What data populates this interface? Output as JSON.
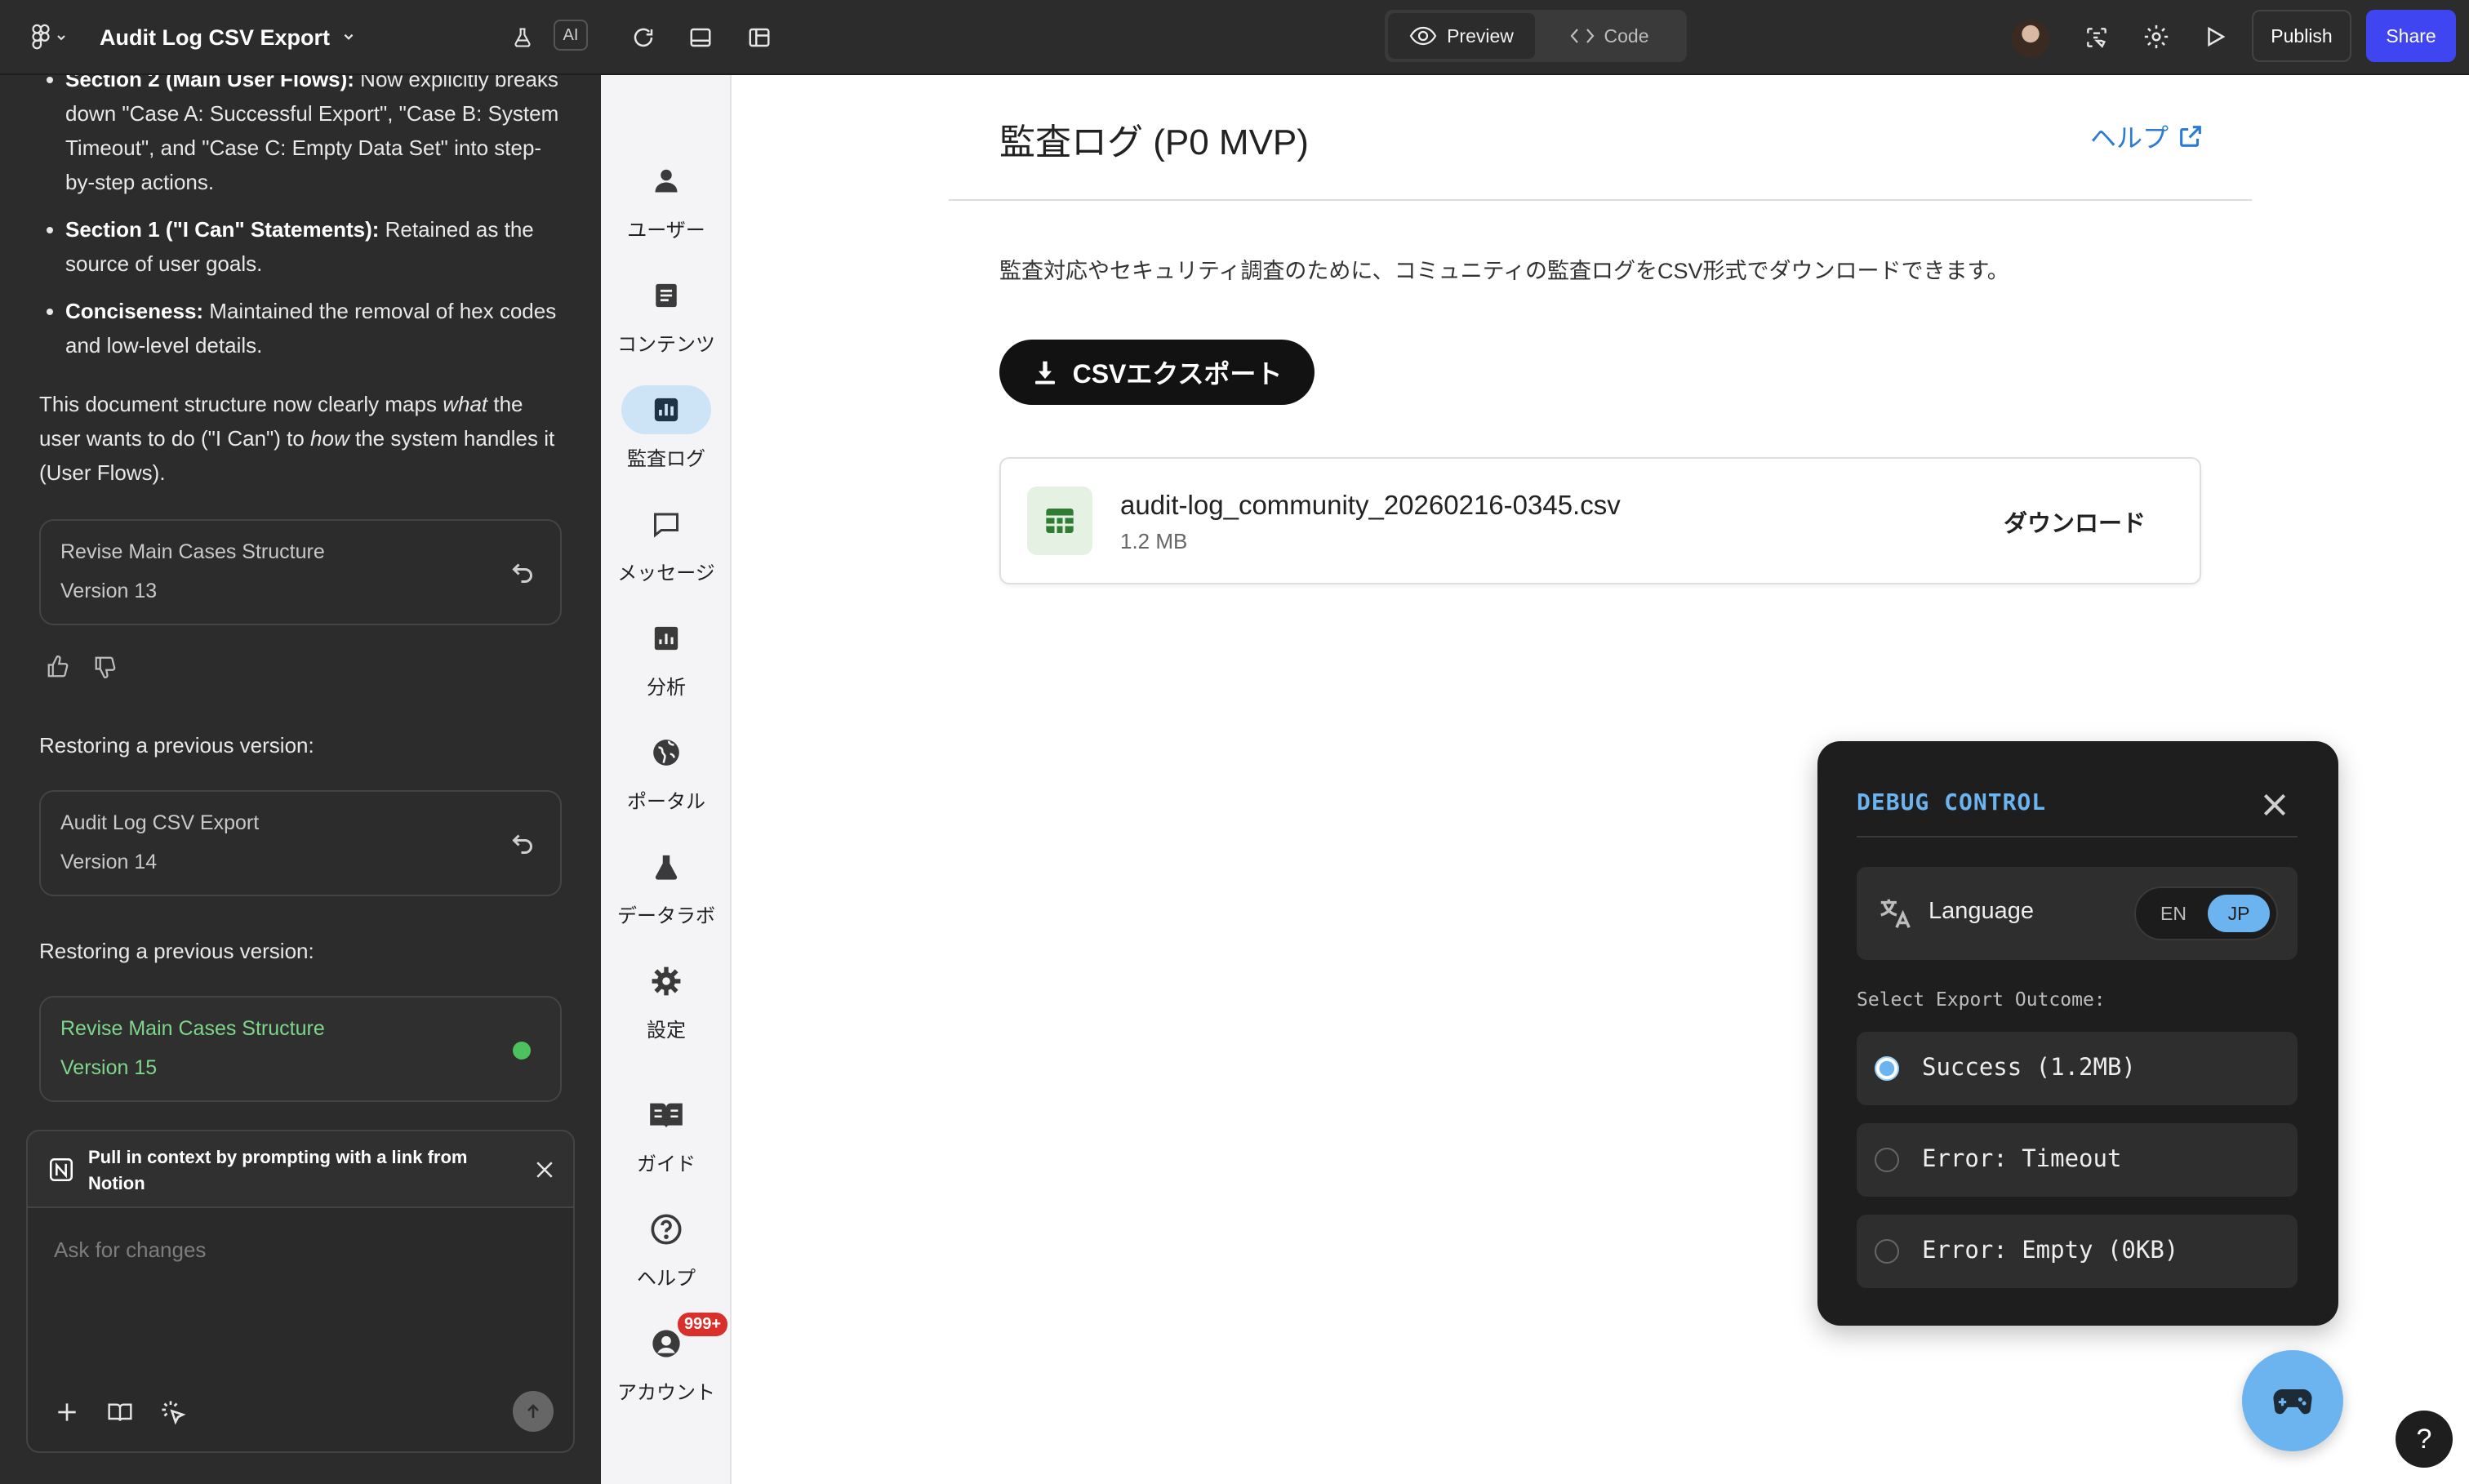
{
  "topbar": {
    "title": "Audit Log CSV Export",
    "ai_label": "AI",
    "preview_label": "Preview",
    "code_label": "Code",
    "publish_label": "Publish",
    "share_label": "Share"
  },
  "chat": {
    "bullets": [
      {
        "bold": "Section 2 (Main User Flows):",
        "text": " Now explicitly breaks down \"Case A: Successful Export\", \"Case B: System Timeout\", and \"Case C: Empty Data Set\" into step-by-step actions."
      },
      {
        "bold": "Section 1 (\"I Can\" Statements):",
        "text": " Retained as the source of user goals."
      },
      {
        "bold": "Conciseness:",
        "text": " Maintained the removal of hex codes and low-level details."
      }
    ],
    "summary": {
      "p1": "This document structure now clearly maps ",
      "em1": "what",
      "p2": " the user wants to do (\"I Can\") to ",
      "em2": "how",
      "p3": " the system handles it (User Flows)."
    },
    "versions": [
      {
        "title": "Revise Main Cases Structure",
        "version": "Version 13"
      },
      {
        "title": "Audit Log CSV Export",
        "version": "Version 14"
      },
      {
        "title": "Revise Main Cases Structure",
        "version": "Version 15"
      }
    ],
    "restoring_label": "Restoring a previous version:",
    "notion_prompt": "Pull in context by prompting with a link from Notion",
    "composer_placeholder": "Ask for changes"
  },
  "nav": {
    "items": [
      {
        "label": "ユーザー",
        "icon": "user-icon"
      },
      {
        "label": "コンテンツ",
        "icon": "document-icon"
      },
      {
        "label": "監査ログ",
        "icon": "bar-chart-icon"
      },
      {
        "label": "メッセージ",
        "icon": "message-icon"
      },
      {
        "label": "分析",
        "icon": "analytics-icon"
      },
      {
        "label": "ポータル",
        "icon": "globe-icon"
      },
      {
        "label": "データラボ",
        "icon": "flask-icon"
      },
      {
        "label": "設定",
        "icon": "gear-icon"
      },
      {
        "label": "ガイド",
        "icon": "book-icon"
      },
      {
        "label": "ヘルプ",
        "icon": "help-circle-icon"
      },
      {
        "label": "アカウント",
        "icon": "account-icon"
      }
    ],
    "account_badge": "999+",
    "active_index": 2
  },
  "main": {
    "title": "監査ログ (P0 MVP)",
    "help_link": "ヘルプ",
    "description": "監査対応やセキュリティ調査のために、コミュニティの監査ログをCSV形式でダウンロードできます。",
    "export_button": "CSVエクスポート",
    "file": {
      "name": "audit-log_community_20260216-0345.csv",
      "size": "1.2 MB",
      "download_label": "ダウンロード"
    }
  },
  "debug": {
    "title": "DEBUG CONTROL",
    "language_label": "Language",
    "lang_options": [
      "EN",
      "JP"
    ],
    "lang_selected": "JP",
    "outcome_label": "Select Export Outcome:",
    "outcomes": [
      "Success (1.2MB)",
      "Error: Timeout",
      "Error: Empty (0KB)"
    ],
    "outcome_selected": 0
  },
  "help_fab": "?",
  "colors": {
    "accent_blue": "#6cb4ef",
    "share_blue": "#3f45f0",
    "version_green": "#7fd68a",
    "badge_red": "#d9302c"
  }
}
